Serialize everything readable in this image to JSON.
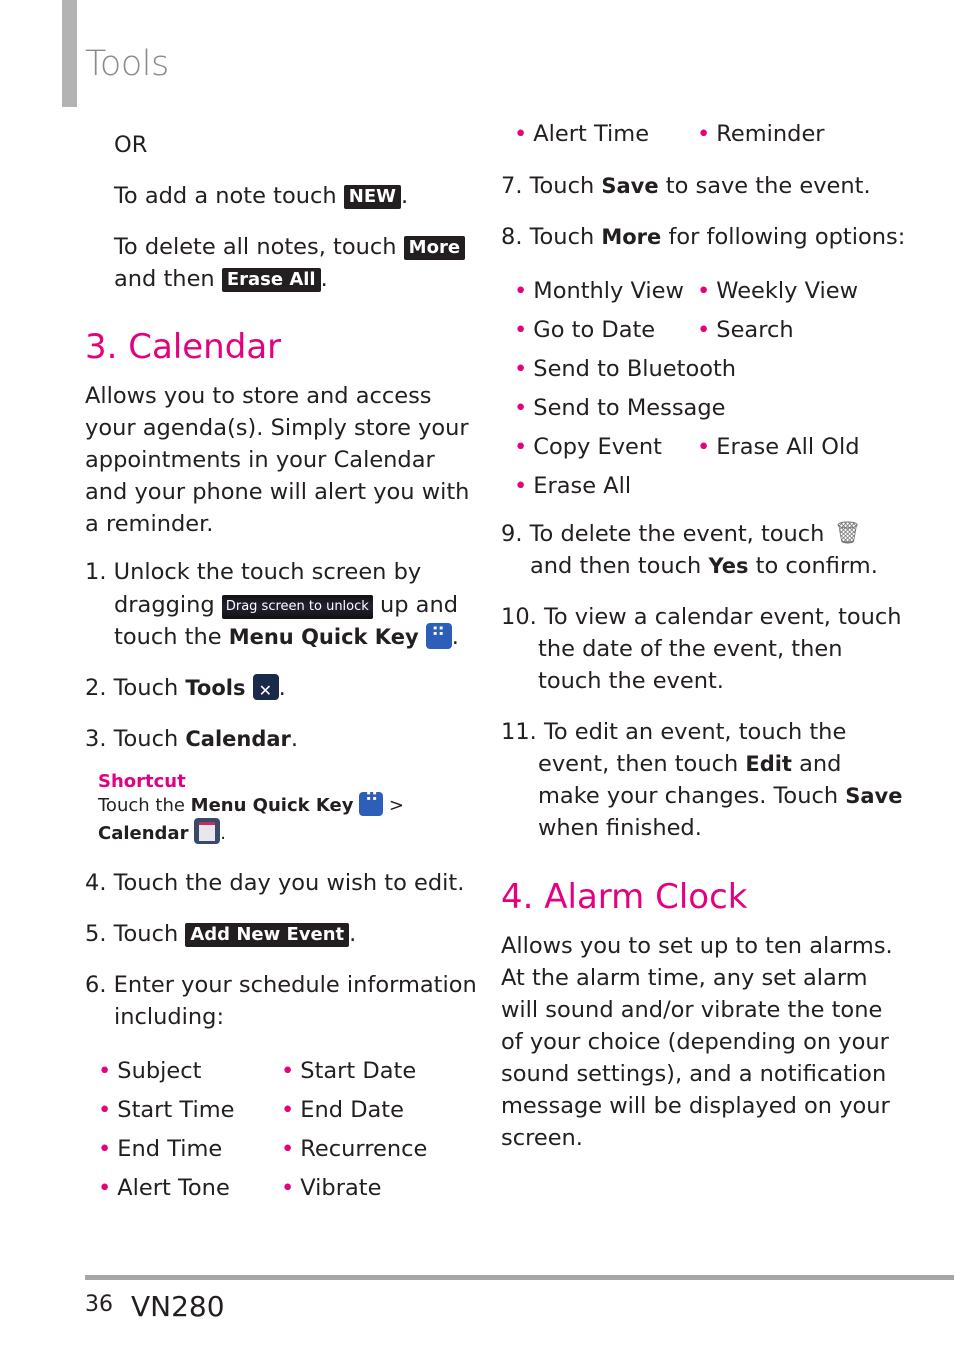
{
  "header": {
    "title": "Tools"
  },
  "left": {
    "or": "OR",
    "add_note": {
      "text": "To add a note touch ",
      "button": "NEW",
      "end": "."
    },
    "delete_notes": {
      "text": "To delete all notes, touch ",
      "button": "More",
      "line2": "and then ",
      "button2": "Erase All",
      "end": "."
    },
    "section_title": "3. Calendar",
    "intro": [
      "Allows you to store and access",
      "your agenda(s). Simply store your",
      "appointments in your Calendar",
      "and your phone will alert you with",
      "a reminder."
    ],
    "step1": {
      "num": "1.",
      "l1": "Unlock the touch screen by",
      "l2a": "dragging ",
      "drag": "Drag screen to unlock",
      "l2b": " up and",
      "l3a": "touch the ",
      "l3b": "Menu Quick Key",
      "end": "."
    },
    "step2": {
      "num": "2.",
      "a": "Touch ",
      "b": "Tools",
      "end": "."
    },
    "step3": {
      "num": "3.",
      "a": "Touch ",
      "b": "Calendar",
      "end": "."
    },
    "shortcut": {
      "label": "Shortcut",
      "l1a": "Touch the ",
      "l1b": "Menu Quick Key",
      "l1c": " >",
      "l2": "Calendar",
      "end": "."
    },
    "step4": {
      "num": "4.",
      "text": "Touch the day you wish to edit."
    },
    "step5": {
      "num": "5.",
      "a": "Touch ",
      "button": "Add New Event",
      "end": "."
    },
    "step6": {
      "num": "6.",
      "l1": "Enter your schedule information",
      "l2": "including:"
    },
    "fields_col1": [
      "Subject",
      "Start Time",
      "End Time",
      "Alert Tone"
    ],
    "fields_col2": [
      "Start Date",
      "End Date",
      "Recurrence",
      "Vibrate"
    ]
  },
  "right": {
    "fields_top": [
      "Alert Time",
      "Reminder"
    ],
    "step7": {
      "num": "7.",
      "a": "Touch ",
      "b": "Save",
      "c": " to save the event."
    },
    "step8": {
      "num": "8.",
      "a": "Touch ",
      "b": "More",
      "c": " for following options:"
    },
    "options": [
      [
        "Monthly View",
        "Weekly View"
      ],
      [
        "Go to Date",
        "Search"
      ],
      [
        "Send to Bluetooth",
        ""
      ],
      [
        "Send to Message",
        ""
      ],
      [
        "Copy Event",
        "Erase All Old"
      ],
      [
        "Erase All",
        ""
      ]
    ],
    "step9": {
      "num": "9.",
      "l1": "To delete the event, touch ",
      "l2a": "and then touch ",
      "l2b": "Yes",
      "l2c": " to confirm."
    },
    "step10": {
      "num": "10.",
      "lines": [
        "To view a calendar event, touch",
        "the date of the event, then",
        "touch the event."
      ]
    },
    "step11": {
      "num": "11.",
      "l1": "To edit an event, touch the",
      "l2a": "event, then touch ",
      "l2b": "Edit",
      "l2c": " and",
      "l3a": "make your changes. Touch ",
      "l3b": "Save",
      "l4": "when finished."
    },
    "section_title": "4. Alarm Clock",
    "alarm_text": [
      "Allows you to set up to ten alarms.",
      "At the alarm time, any set alarm",
      "will sound and/or vibrate the tone",
      "of your choice (depending on your",
      "sound settings), and a notification",
      "message will be displayed on your",
      "screen."
    ]
  },
  "footer": {
    "page": "36",
    "model": "VN280"
  },
  "colors": {
    "accent": "#e5007e",
    "title_gray": "#8a8a8a",
    "bar_gray": "#b3b3b3"
  }
}
